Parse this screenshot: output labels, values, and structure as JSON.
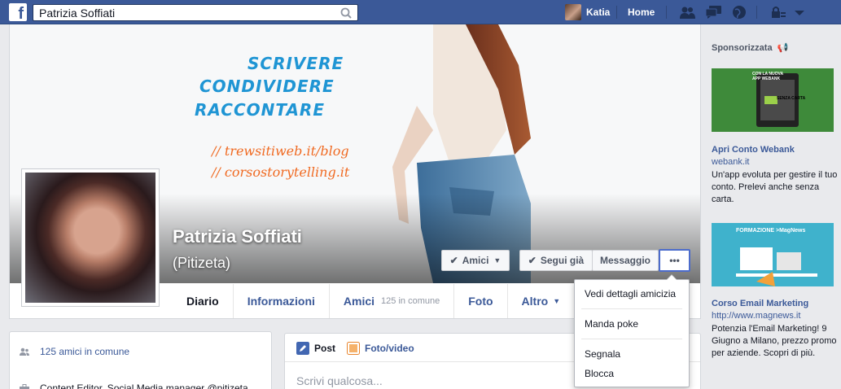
{
  "topbar": {
    "logo": "f",
    "search_value": "Patrizia Soffiati",
    "user_name": "Katia",
    "home_label": "Home",
    "icons": [
      "friend-requests-icon",
      "messages-icon",
      "notifications-globe-icon",
      "privacy-lock-icon",
      "account-menu-caret-icon"
    ]
  },
  "cover": {
    "text_lines": [
      "SCRIVERE",
      "CONDIVIDERE",
      "RACCONTARE"
    ],
    "links": [
      "// trewsitiweb.it/blog",
      "// corsostorytelling.it"
    ]
  },
  "profile": {
    "name": "Patrizia Soffiati",
    "alt_name": "(Pitizeta)"
  },
  "actions": {
    "friends": "Amici",
    "following": "Segui già",
    "message": "Messaggio",
    "more": "•••"
  },
  "tabs": {
    "timeline": "Diario",
    "about": "Informazioni",
    "friends": "Amici",
    "friends_sub": "125 in comune",
    "photos": "Foto",
    "more": "Altro"
  },
  "dropdown": {
    "items": [
      "Vedi dettagli amicizia",
      "Manda poke",
      "Segnala",
      "Blocca"
    ]
  },
  "leftbox": {
    "mutual": "125 amici in comune",
    "work": "Content Editor, Social Media manager @pitizeta"
  },
  "composer": {
    "post_tab": "Post",
    "photo_tab": "Foto/video",
    "placeholder": "Scrivi qualcosa..."
  },
  "sidebar": {
    "heading": "Sponsorizzata",
    "ads": [
      {
        "title": "Apri Conto Webank",
        "url": "webank.it",
        "body": "Un'app evoluta per gestire il tuo conto. Prelevi anche senza carta.",
        "image_text": [
          "CON LA NUOVA",
          "APP WEBANK",
          "SENZA CARTA"
        ]
      },
      {
        "title": "Corso Email Marketing",
        "url": "http://www.magnews.it",
        "body": "Potenzia l'Email Marketing! 9 Giugno a Milano, prezzo promo per aziende. Scopri di più.",
        "image_text": "FORMAZIONE >MagNews"
      }
    ]
  },
  "colors": {
    "brand_blue": "#3b5998",
    "link_blue": "#3b5998",
    "cover_text": "#1f95d4",
    "cover_link": "#f06a22"
  }
}
